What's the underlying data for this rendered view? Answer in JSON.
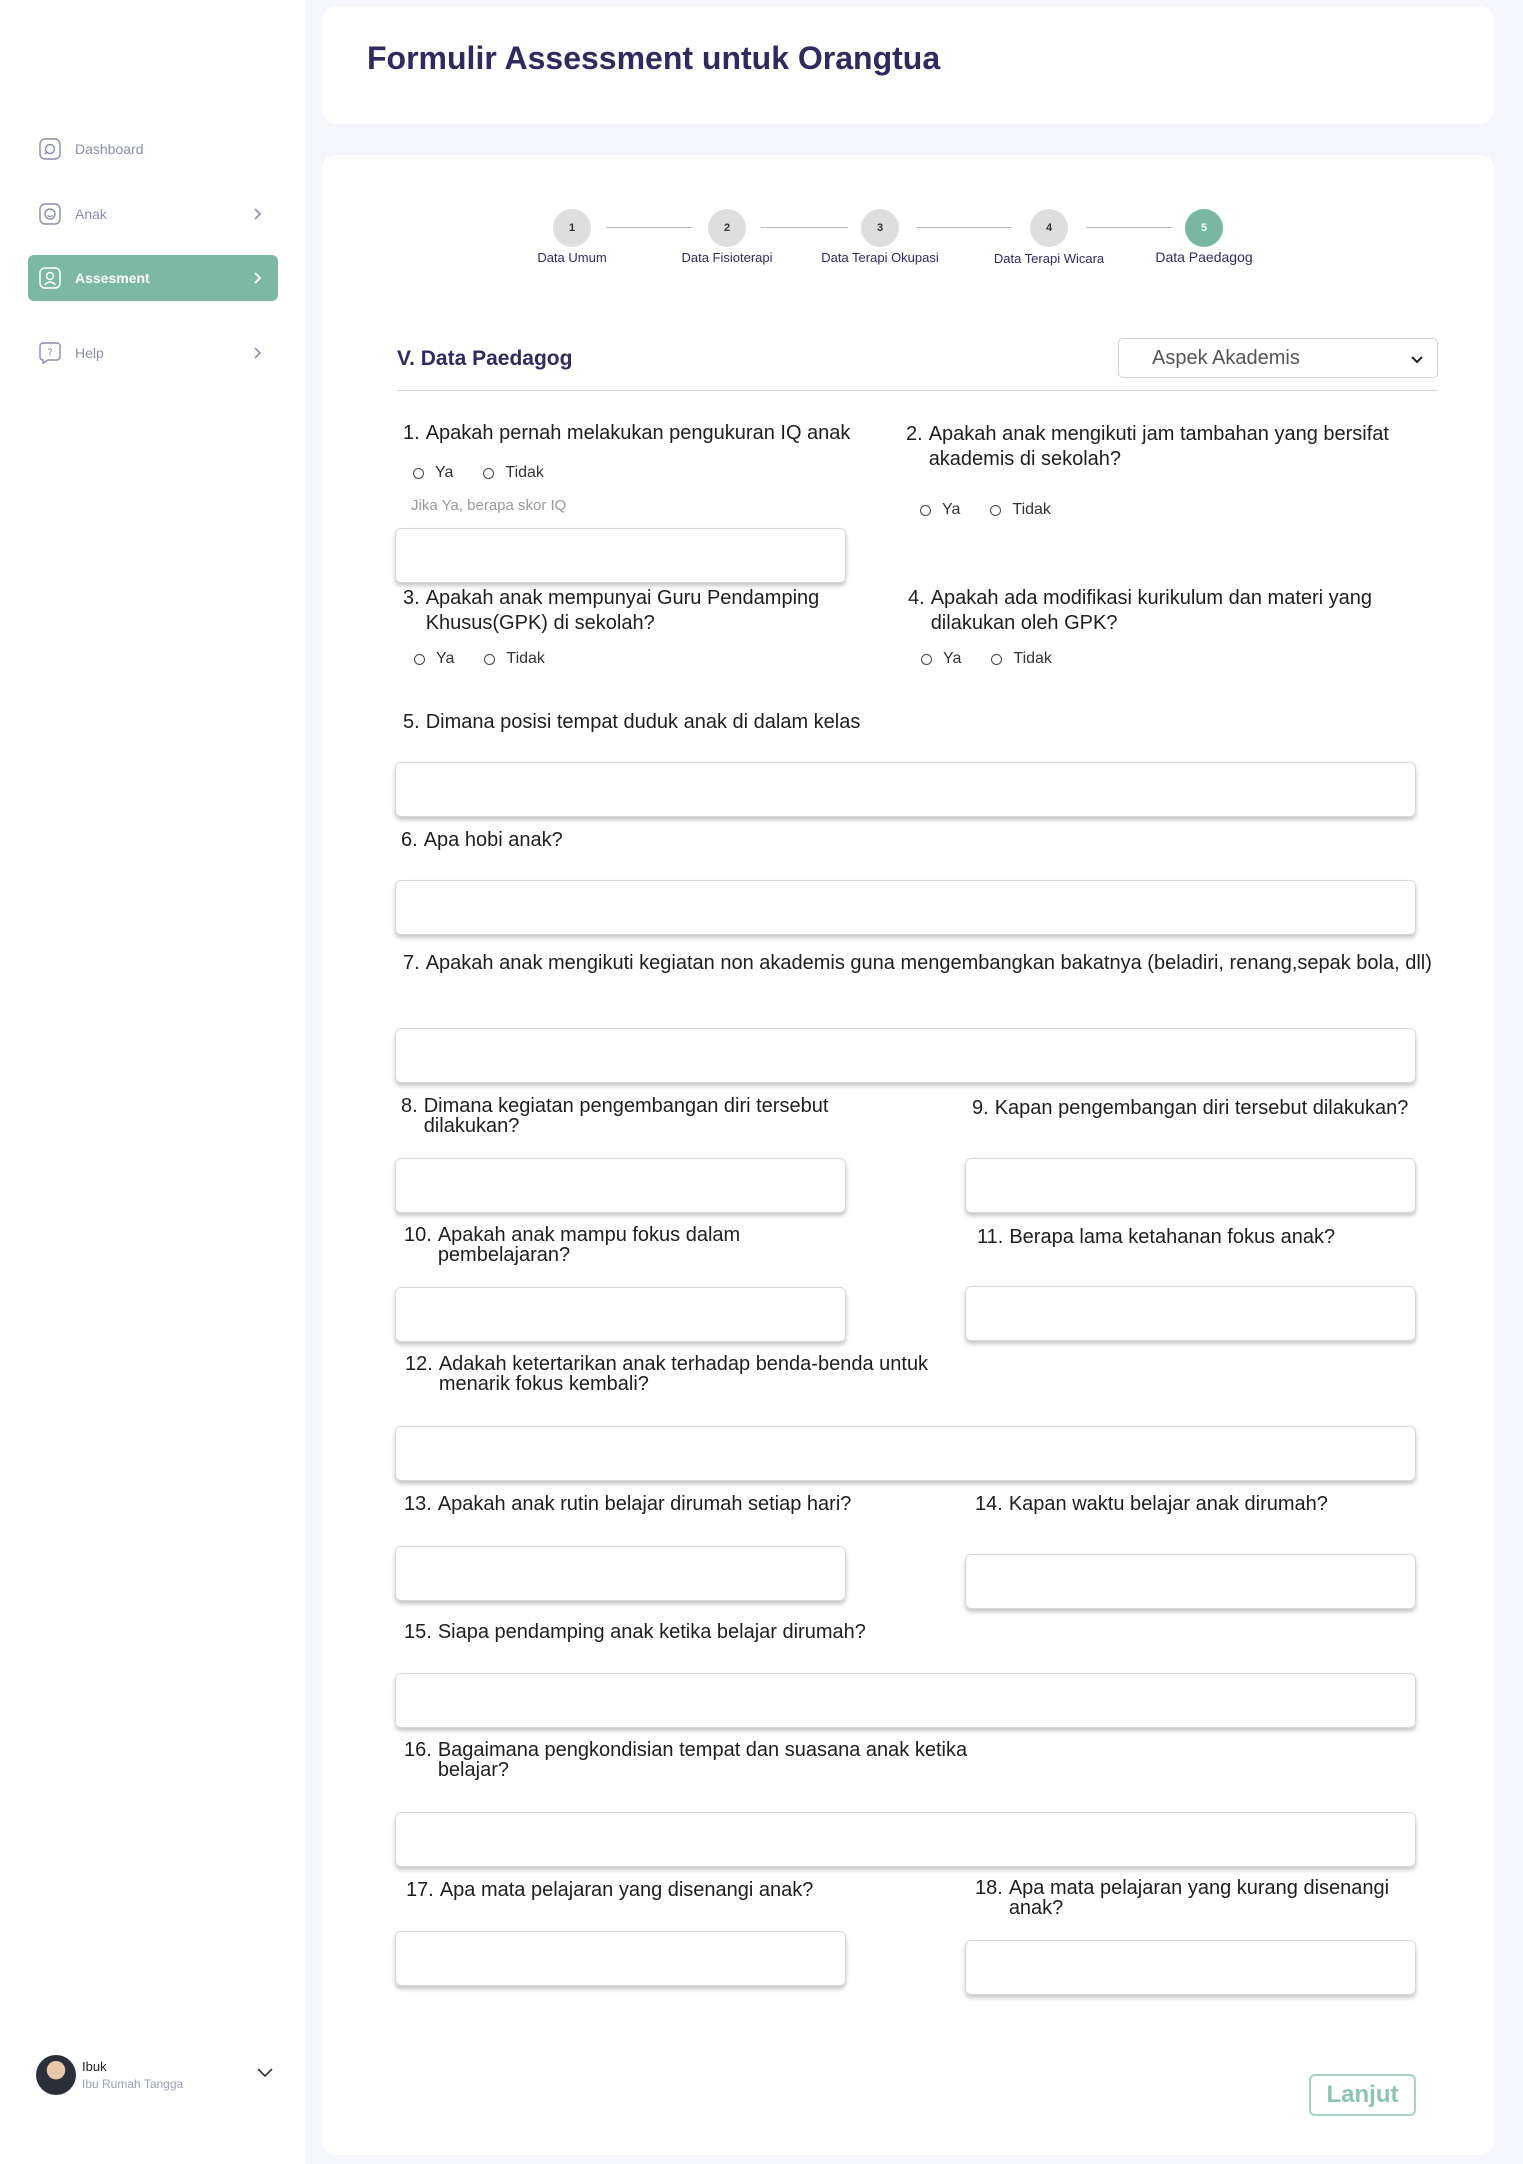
{
  "sidebar": {
    "items": [
      {
        "label": "Dashboard",
        "icon": "dashboard-icon"
      },
      {
        "label": "Anak",
        "icon": "child-icon"
      },
      {
        "label": "Assesment",
        "icon": "assessment-icon"
      },
      {
        "label": "Help",
        "icon": "help-icon"
      }
    ],
    "active_color": "#7db8a5",
    "user": {
      "name": "Ibuk",
      "role": "Ibu Rumah Tangga"
    }
  },
  "header": {
    "title": "Formulir Assessment untuk Orangtua"
  },
  "stepper": {
    "steps": [
      {
        "number": "1",
        "label": "Data Umum"
      },
      {
        "number": "2",
        "label": "Data Fisioterapi"
      },
      {
        "number": "3",
        "label": "Data Terapi Okupasi"
      },
      {
        "number": "4",
        "label": "Data Terapi Wicara"
      },
      {
        "number": "5",
        "label": "Data Paedagog"
      }
    ],
    "active_step": 5
  },
  "form": {
    "section_title": "V. Data Paedagog",
    "aspect_select": "Aspek Akademis",
    "radio": {
      "yes": "Ya",
      "no": "Tidak"
    },
    "iq_hint": "Jika Ya, berapa skor  IQ",
    "questions": [
      {
        "num": "1.",
        "text": "Apakah pernah melakukan pengukuran IQ anak"
      },
      {
        "num": "2.",
        "text": "Apakah anak mengikuti jam tambahan yang bersifat akademis di sekolah?"
      },
      {
        "num": "3.",
        "text": "Apakah anak mempunyai Guru Pendamping Khusus(GPK) di sekolah?"
      },
      {
        "num": "4.",
        "text": "Apakah ada modifikasi kurikulum dan materi yang dilakukan oleh GPK?"
      },
      {
        "num": "5.",
        "text": "Dimana posisi tempat duduk anak di dalam kelas"
      },
      {
        "num": "6.",
        "text": "Apa hobi anak?"
      },
      {
        "num": "7.",
        "text": "Apakah anak mengikuti kegiatan non akademis guna mengembangkan bakatnya (beladiri, renang,sepak bola, dll)"
      },
      {
        "num": "8.",
        "text": "Dimana kegiatan pengembangan diri tersebut dilakukan?"
      },
      {
        "num": "9.",
        "text": "Kapan pengembangan diri tersebut dilakukan?"
      },
      {
        "num": "10.",
        "text": "Apakah anak mampu fokus dalam pembelajaran?"
      },
      {
        "num": "11.",
        "text": "Berapa lama ketahanan fokus anak?"
      },
      {
        "num": "12.",
        "text": "Adakah ketertarikan anak terhadap benda-benda untuk menarik fokus kembali?"
      },
      {
        "num": "13.",
        "text": "Apakah anak rutin belajar dirumah setiap hari?"
      },
      {
        "num": "14.",
        "text": "Kapan waktu belajar anak dirumah?"
      },
      {
        "num": "15.",
        "text": "Siapa pendamping anak ketika belajar dirumah?"
      },
      {
        "num": "16.",
        "text": "Bagaimana pengkondisian tempat dan suasana anak ketika belajar?"
      },
      {
        "num": "17.",
        "text": "Apa mata pelajaran yang disenangi anak?"
      },
      {
        "num": "18.",
        "text": "Apa mata pelajaran yang kurang disenangi anak?"
      }
    ],
    "next_button": "Lanjut"
  }
}
